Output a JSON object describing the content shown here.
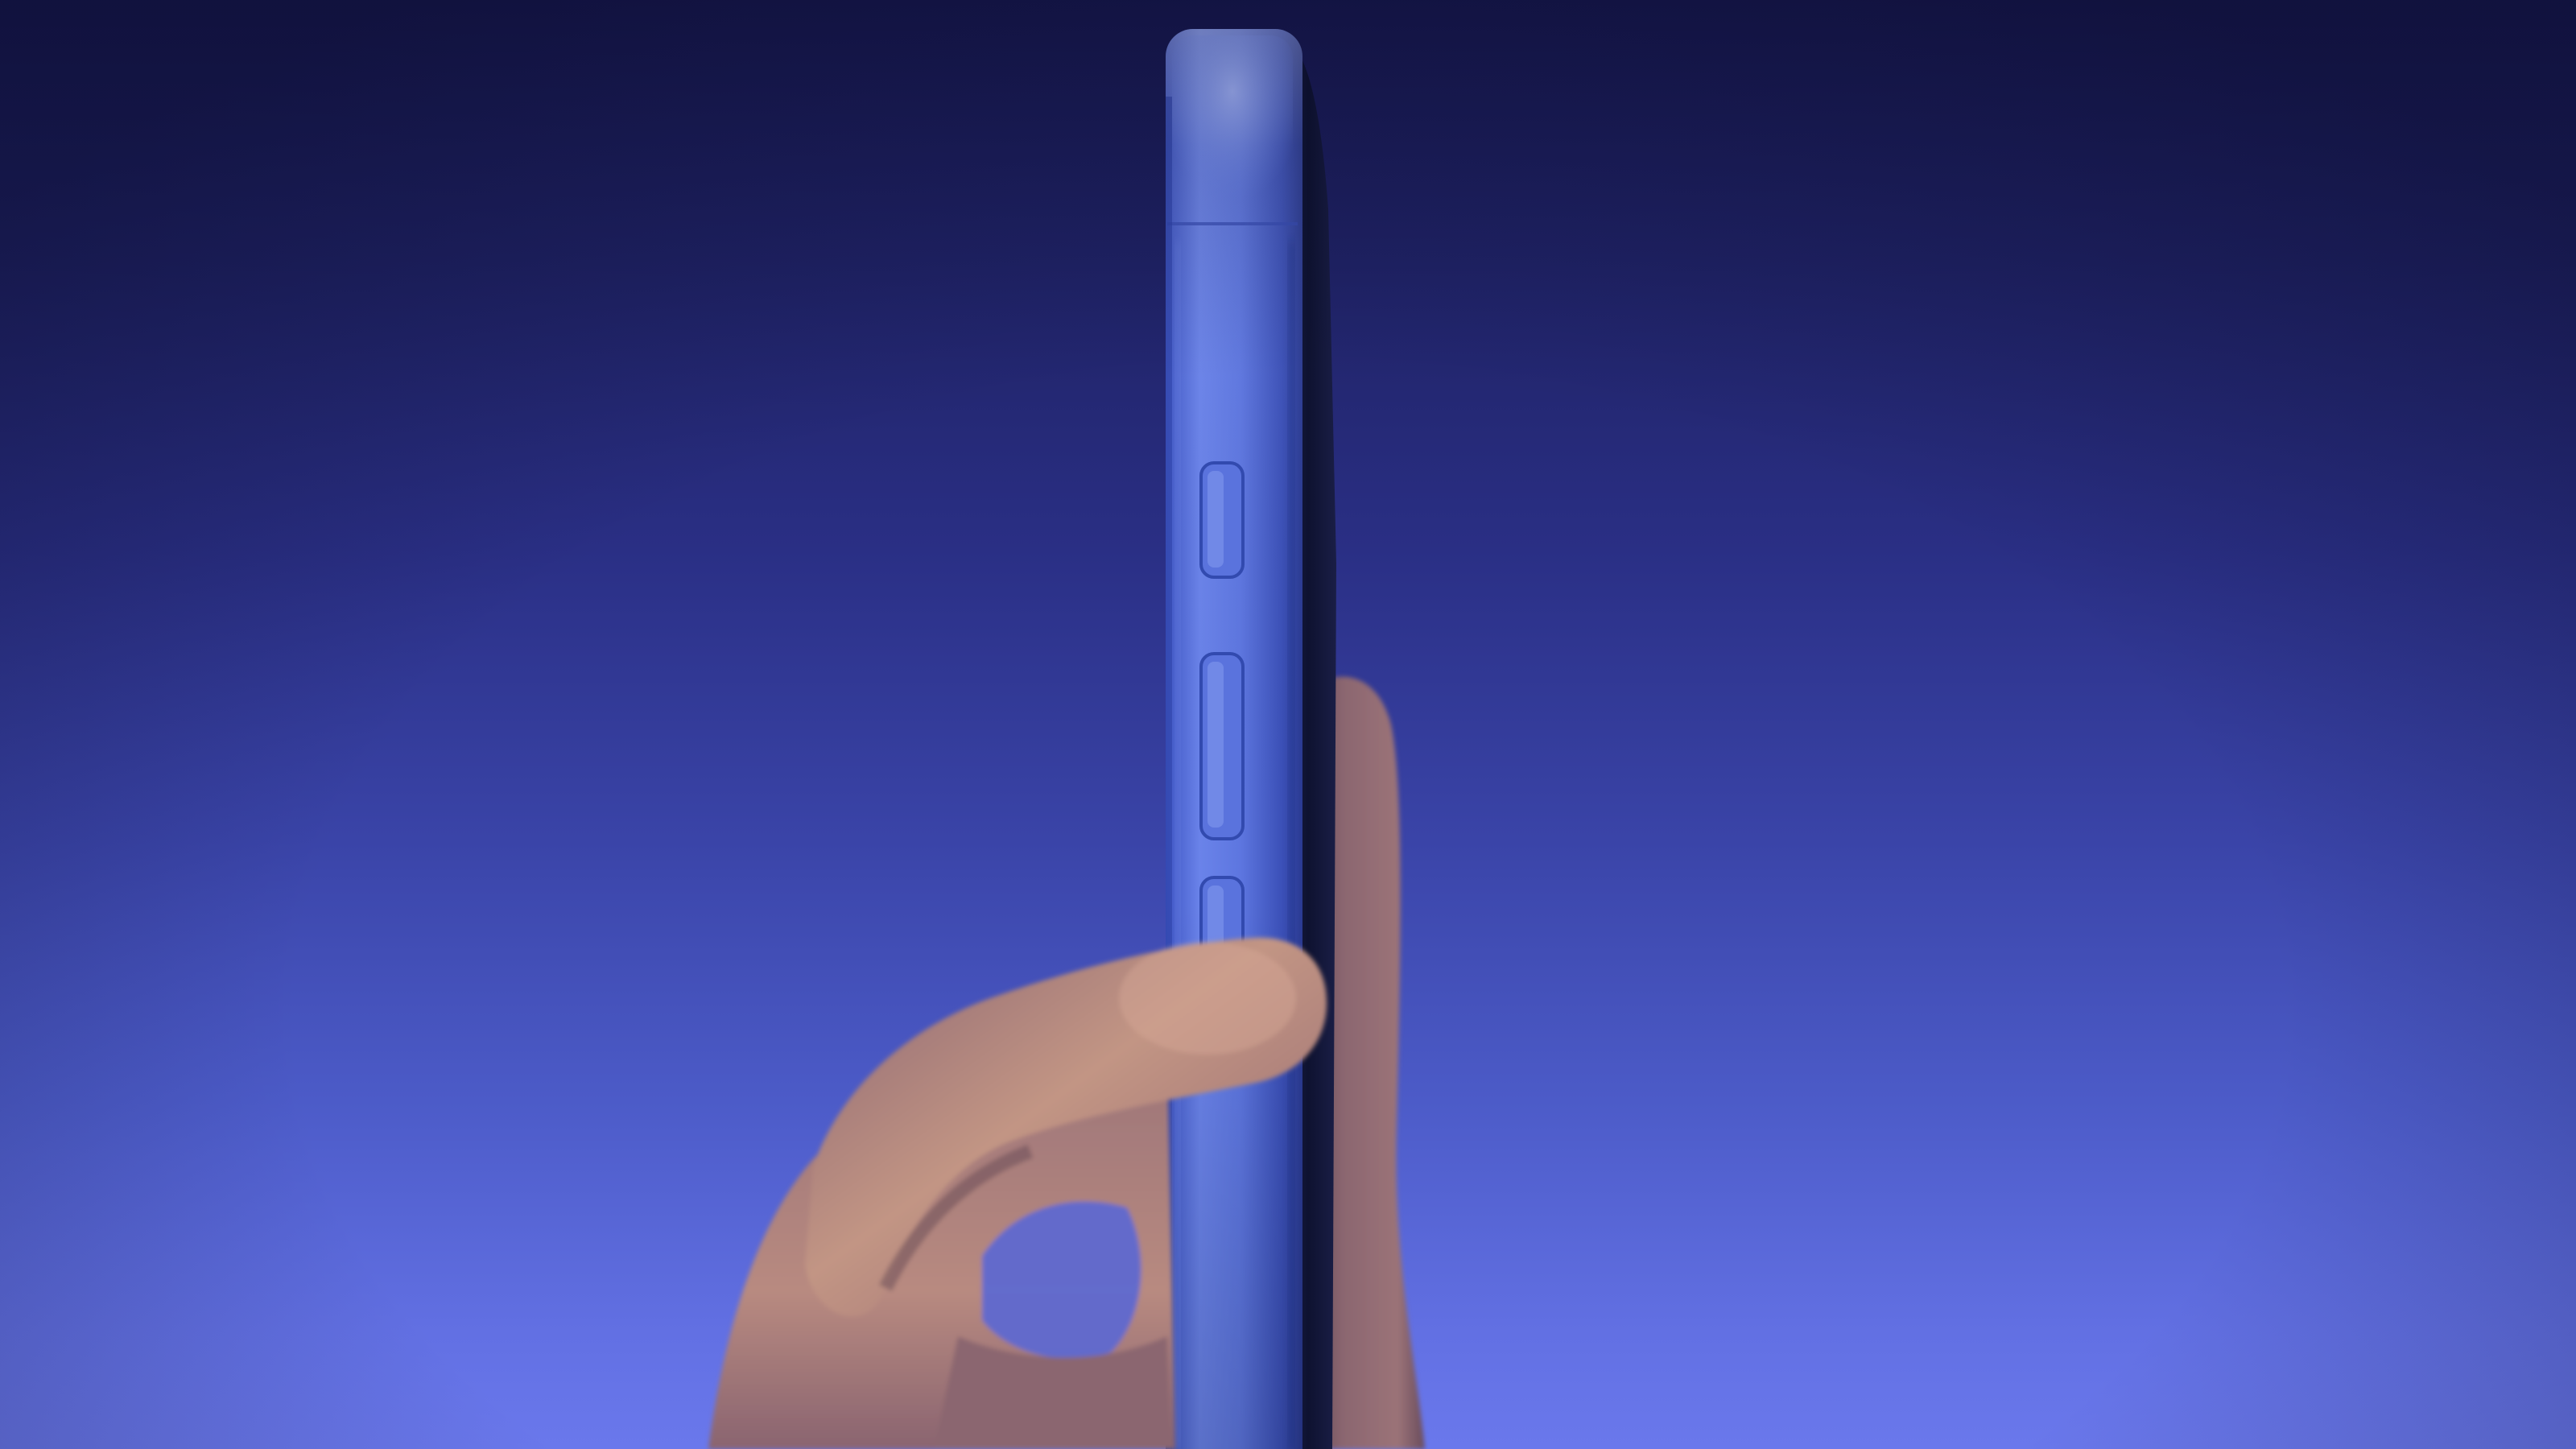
{
  "scene": {
    "subject": "hand-holding-phone-side-view",
    "colors": {
      "background_top": "#17184f",
      "background_bottom": "#6a78ec",
      "phone_frame": "#4f68d8",
      "phone_frame_highlight": "#7e95f2",
      "phone_back": "#10142e",
      "skin": "#b8877a",
      "skin_shadow": "#6e4a4a"
    },
    "icons": [
      "phone-icon",
      "hand-icon"
    ]
  }
}
